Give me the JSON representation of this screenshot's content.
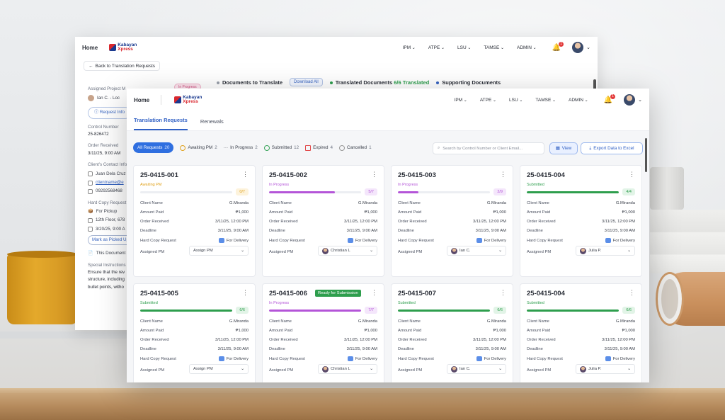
{
  "colors": {
    "accent": "#2f6fe0",
    "awaiting": "#e0a21c",
    "in_progress": "#b455d8",
    "submitted": "#2e9e4d"
  },
  "back": {
    "nav": {
      "home": "Home",
      "brand_line1": "Kabayan",
      "brand_line2": "Xpress",
      "menus": [
        "IPM",
        "ATPE",
        "LSU",
        "TAMSE",
        "ADMIN"
      ],
      "badge": "1"
    },
    "back_label": "Back to Translation Requests",
    "tag": "In Progress",
    "tabs": {
      "docs": "Documents to Translate",
      "download": "Download All",
      "translated": "Translated Documents",
      "translated_count": "6/6 Translated",
      "supporting": "Supporting Documents"
    },
    "left": {
      "assigned_label": "Assigned Project M",
      "assigned_name": "Ian C. - Loc",
      "request_info": "Request Info",
      "control_label": "Control Number",
      "control_value": "25-826472",
      "order_label": "Order Received",
      "order_value": "3/11/25, 9:00 AM",
      "contact_label": "Client's Contact Info",
      "contact_name": "Juan Dela Cruz",
      "contact_email": "clientname@e",
      "contact_phone": "09292568468",
      "hardcopy_label": "Hard Copy Request",
      "pickup": "For Pickup",
      "address": "12th Floor, 678",
      "date": "3/20/25, 9:00 A",
      "mark_btn": "Mark as Picked Up",
      "doc_note": "This Document",
      "special_label": "Special Instructions",
      "special_1": "Ensure that the rev",
      "special_2": "structure, including",
      "special_3": "bullet points, witho"
    }
  },
  "front": {
    "nav": {
      "home": "Home",
      "brand_line1": "Kabayan",
      "brand_line2": "Xpress",
      "menus": [
        "IPM",
        "ATPE",
        "LSU",
        "TAMSE",
        "ADMIN"
      ],
      "badge": "1"
    },
    "tabs": [
      "Translation Requests",
      "Renewals"
    ],
    "filters": [
      {
        "label": "All Requests",
        "count": "20"
      },
      {
        "label": "Awaiting PM",
        "count": "2"
      },
      {
        "label": "In Progress",
        "count": "2"
      },
      {
        "label": "Submitted",
        "count": "12"
      },
      {
        "label": "Expired",
        "count": "4"
      },
      {
        "label": "Cancelled",
        "count": "1"
      }
    ],
    "search_placeholder": "Search by Control Number or Client Email...",
    "view_label": "View",
    "export_label": "Export Data to Excel",
    "labels": {
      "client": "Client Name",
      "paid": "Amount Paid",
      "order": "Order Received",
      "deadline": "Deadline",
      "hardcopy": "Hard Copy Request",
      "pm": "Assigned PM"
    },
    "cards": [
      {
        "id": "25-0415-001",
        "status": "Awaiting PM",
        "progress": "0/7",
        "progress_value": 0,
        "client": "G.Miranda",
        "paid": "₱1,000",
        "order": "3/11/25, 12:00 PM",
        "deadline": "3/11/25, 9:00 AM",
        "hardcopy": "For Delivery",
        "pm": "Assign PM",
        "ready": ""
      },
      {
        "id": "25-0415-002",
        "status": "In Progress",
        "progress": "5/7",
        "progress_value": 0.714,
        "client": "G.Miranda",
        "paid": "₱1,000",
        "order": "3/11/25, 12:00 PM",
        "deadline": "3/11/25, 9:00 AM",
        "hardcopy": "For Delivery",
        "pm": "Christian L",
        "ready": ""
      },
      {
        "id": "25-0415-003",
        "status": "In Progress",
        "progress": "2/9",
        "progress_value": 0.222,
        "client": "G.Miranda",
        "paid": "₱1,000",
        "order": "3/11/25, 12:00 PM",
        "deadline": "3/11/25, 9:00 AM",
        "hardcopy": "For Delivery",
        "pm": "Ian C.",
        "ready": ""
      },
      {
        "id": "25-0415-004",
        "status": "Submitted",
        "progress": "4/4",
        "progress_value": 1,
        "client": "G.Miranda",
        "paid": "₱1,000",
        "order": "3/11/25, 12:00 PM",
        "deadline": "3/11/25, 9:00 AM",
        "hardcopy": "For Delivery",
        "pm": "Julia P.",
        "ready": ""
      },
      {
        "id": "25-0415-005",
        "status": "Submitted",
        "progress": "6/6",
        "progress_value": 1,
        "client": "G.Miranda",
        "paid": "₱1,000",
        "order": "3/11/25, 12:00 PM",
        "deadline": "3/11/25, 9:00 AM",
        "hardcopy": "For Delivery",
        "pm": "Assign PM",
        "ready": ""
      },
      {
        "id": "25-0415-006",
        "status": "In Progress",
        "progress": "7/7",
        "progress_value": 1,
        "client": "G.Miranda",
        "paid": "₱1,000",
        "order": "3/11/25, 12:00 PM",
        "deadline": "3/11/25, 9:00 AM",
        "hardcopy": "For Delivery",
        "pm": "Christian L",
        "ready": "Ready for Submission"
      },
      {
        "id": "25-0415-007",
        "status": "Submitted",
        "progress": "6/6",
        "progress_value": 1,
        "client": "G.Miranda",
        "paid": "₱1,000",
        "order": "3/11/25, 12:00 PM",
        "deadline": "3/11/25, 9:00 AM",
        "hardcopy": "For Delivery",
        "pm": "Ian C.",
        "ready": ""
      },
      {
        "id": "25-0415-004",
        "status": "Submitted",
        "progress": "6/6",
        "progress_value": 1,
        "client": "G.Miranda",
        "paid": "₱1,000",
        "order": "3/11/25, 12:00 PM",
        "deadline": "3/11/25, 9:00 AM",
        "hardcopy": "For Delivery",
        "pm": "Julia P.",
        "ready": ""
      }
    ]
  }
}
